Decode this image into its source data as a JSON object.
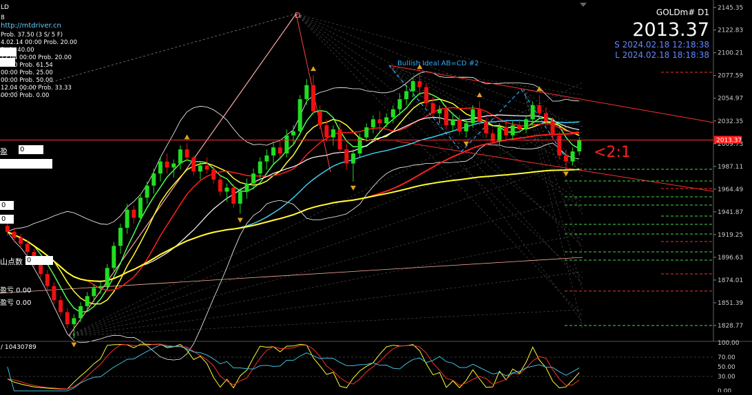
{
  "header": {
    "symbol": "GOLDm# D1",
    "price": "2013.37",
    "session_s": "S 2024.02.18 12:18:38",
    "session_l": "L 2024.02.18 18:18:38",
    "corner_left_top": "LD",
    "corner_left_2": "8",
    "link": "http://mtdriver.cn",
    "prob_lines": [
      "Prob. 37.50 (3 S/ 5 F)",
      "4.02.14 00:00 Prob. 20.00",
      "Prob. 40.00",
      "12.04 00:00 Prob. 20.00",
      "00:00 Prob. 61.54",
      "00:00 Prob. 25.00",
      "00:00 Prob. 50.00",
      "12.04 00:00 Prob. 33.33",
      "00:00 Prob. 0.00"
    ]
  },
  "annotations": {
    "pattern": "Bullish Ideal AB=CD #2",
    "ratio": "<2:1",
    "point_d": "D",
    "panel_left_1": "盈",
    "panel_left_1_val": "0",
    "panel_left_2": "0",
    "panel_left_3": "0",
    "panel_left_4": "山点数",
    "panel_left_4_val": "0",
    "panel_left_5": "盈亏 0.00",
    "panel_left_6": "盈亏 0.00",
    "oscillator_label": "/ 10430789"
  },
  "colors": {
    "background": "#000000",
    "bull": "#22dd22",
    "bear": "#ee1111",
    "ma_red": "#ff2020",
    "ma_yellow": "#ffff30",
    "ma_white": "#ffffff",
    "ma_cyan": "#40d0f0",
    "ma_green": "#50ff50",
    "bands": "#ffffff",
    "price_line": "#ff3030"
  },
  "chart_data": {
    "type": "candlestick",
    "timeframe": "D1",
    "ylim": [
      1813,
      2150
    ],
    "y_ticks": [
      2145.35,
      2122.83,
      2100.21,
      2077.59,
      2054.97,
      2032.35,
      2009.73,
      1987.11,
      1964.49,
      1941.87,
      1919.25,
      1896.63,
      1874.01,
      1851.39,
      1828.77
    ],
    "current_price": 2013.37,
    "ohlc": [
      [
        1928,
        1934,
        1918,
        1922
      ],
      [
        1922,
        1926,
        1912,
        1916
      ],
      [
        1916,
        1920,
        1906,
        1910
      ],
      [
        1910,
        1914,
        1898,
        1902
      ],
      [
        1902,
        1905,
        1886,
        1890
      ],
      [
        1890,
        1894,
        1876,
        1880
      ],
      [
        1880,
        1884,
        1864,
        1868
      ],
      [
        1868,
        1872,
        1850,
        1854
      ],
      [
        1854,
        1858,
        1838,
        1842
      ],
      [
        1842,
        1846,
        1826,
        1830
      ],
      [
        1830,
        1840,
        1816,
        1836
      ],
      [
        1836,
        1852,
        1832,
        1848
      ],
      [
        1848,
        1862,
        1844,
        1858
      ],
      [
        1858,
        1870,
        1852,
        1866
      ],
      [
        1866,
        1872,
        1860,
        1868
      ],
      [
        1868,
        1890,
        1864,
        1886
      ],
      [
        1886,
        1912,
        1882,
        1908
      ],
      [
        1908,
        1930,
        1900,
        1926
      ],
      [
        1926,
        1950,
        1920,
        1944
      ],
      [
        1944,
        1948,
        1930,
        1936
      ],
      [
        1936,
        1960,
        1932,
        1956
      ],
      [
        1956,
        1972,
        1950,
        1968
      ],
      [
        1968,
        1985,
        1960,
        1980
      ],
      [
        1980,
        1996,
        1972,
        1992
      ],
      [
        1992,
        2000,
        1980,
        1986
      ],
      [
        1986,
        1994,
        1976,
        1990
      ],
      [
        1990,
        2008,
        1984,
        2004
      ],
      [
        2004,
        2010,
        1992,
        1996
      ],
      [
        1996,
        1998,
        1978,
        1982
      ],
      [
        1982,
        1992,
        1974,
        1988
      ],
      [
        1988,
        1996,
        1980,
        1984
      ],
      [
        1984,
        1988,
        1970,
        1974
      ],
      [
        1974,
        1978,
        1958,
        1962
      ],
      [
        1962,
        1970,
        1952,
        1966
      ],
      [
        1966,
        1970,
        1946,
        1950
      ],
      [
        1950,
        1966,
        1940,
        1962
      ],
      [
        1962,
        1975,
        1955,
        1970
      ],
      [
        1970,
        1985,
        1964,
        1980
      ],
      [
        1980,
        1996,
        1974,
        1992
      ],
      [
        1992,
        2004,
        1984,
        1998
      ],
      [
        1998,
        2012,
        1990,
        2006
      ],
      [
        2006,
        2014,
        1996,
        2000
      ],
      [
        2000,
        2024,
        1996,
        2018
      ],
      [
        2018,
        2028,
        2008,
        2022
      ],
      [
        2022,
        2058,
        2018,
        2054
      ],
      [
        2054,
        2074,
        2048,
        2068
      ],
      [
        2068,
        2078,
        2038,
        2042
      ],
      [
        2042,
        2048,
        2024,
        2028
      ],
      [
        2028,
        2034,
        2012,
        2016
      ],
      [
        2016,
        2028,
        2008,
        2024
      ],
      [
        2024,
        2030,
        2000,
        2004
      ],
      [
        2004,
        2010,
        1984,
        1990
      ],
      [
        1990,
        2004,
        1972,
        2000
      ],
      [
        2000,
        2020,
        1996,
        2016
      ],
      [
        2016,
        2030,
        2012,
        2026
      ],
      [
        2026,
        2038,
        2020,
        2034
      ],
      [
        2034,
        2042,
        2022,
        2030
      ],
      [
        2030,
        2040,
        2026,
        2036
      ],
      [
        2036,
        2048,
        2030,
        2044
      ],
      [
        2044,
        2060,
        2038,
        2054
      ],
      [
        2054,
        2068,
        2048,
        2062
      ],
      [
        2062,
        2076,
        2056,
        2072
      ],
      [
        2072,
        2080,
        2060,
        2066
      ],
      [
        2066,
        2070,
        2046,
        2050
      ],
      [
        2050,
        2056,
        2036,
        2040
      ],
      [
        2040,
        2048,
        2030,
        2044
      ],
      [
        2044,
        2048,
        2024,
        2028
      ],
      [
        2028,
        2040,
        2022,
        2034
      ],
      [
        2034,
        2038,
        2018,
        2022
      ],
      [
        2022,
        2034,
        2016,
        2030
      ],
      [
        2030,
        2048,
        2026,
        2044
      ],
      [
        2044,
        2052,
        2028,
        2032
      ],
      [
        2032,
        2036,
        2016,
        2020
      ],
      [
        2020,
        2024,
        2008,
        2012
      ],
      [
        2012,
        2030,
        2008,
        2026
      ],
      [
        2026,
        2032,
        2014,
        2018
      ],
      [
        2018,
        2032,
        2014,
        2028
      ],
      [
        2028,
        2034,
        2020,
        2024
      ],
      [
        2024,
        2038,
        2020,
        2034
      ],
      [
        2034,
        2052,
        2028,
        2048
      ],
      [
        2048,
        2058,
        2036,
        2040
      ],
      [
        2040,
        2046,
        2028,
        2032
      ],
      [
        2032,
        2036,
        2014,
        2018
      ],
      [
        2018,
        2022,
        1994,
        1998
      ],
      [
        1998,
        2004,
        1986,
        1992
      ],
      [
        1992,
        2006,
        1988,
        2002
      ],
      [
        2002,
        2016,
        1998,
        2013.37
      ]
    ]
  }
}
